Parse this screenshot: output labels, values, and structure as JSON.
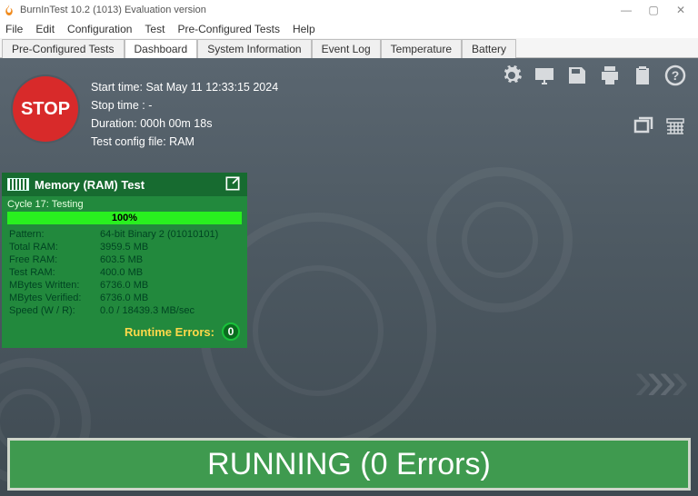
{
  "window": {
    "title": "BurnInTest 10.2 (1013) Evaluation version"
  },
  "menu": {
    "items": [
      "File",
      "Edit",
      "Configuration",
      "Test",
      "Pre-Configured Tests",
      "Help"
    ]
  },
  "tabs": {
    "items": [
      "Pre-Configured Tests",
      "Dashboard",
      "System Information",
      "Event Log",
      "Temperature",
      "Battery"
    ],
    "active": "Dashboard"
  },
  "stop_label": "STOP",
  "info": {
    "start_label": "Start time:",
    "start_value": "Sat May 11 12:33:15 2024",
    "stop_label": "Stop time :",
    "stop_value": "-",
    "duration_label": "Duration:",
    "duration_value": "000h 00m 18s",
    "config_label": "Test config file:",
    "config_value": "RAM"
  },
  "panel": {
    "title": "Memory (RAM) Test",
    "cycle": "Cycle 17: Testing",
    "progress_pct": "100%",
    "progress_fill": "100%",
    "rows": [
      {
        "k": "Pattern:",
        "v": "64-bit Binary 2 (01010101)"
      },
      {
        "k": "Total RAM:",
        "v": "3959.5 MB"
      },
      {
        "k": "Free RAM:",
        "v": "603.5 MB"
      },
      {
        "k": "Test RAM:",
        "v": "400.0 MB"
      },
      {
        "k": "MBytes Written:",
        "v": "6736.0 MB"
      },
      {
        "k": "MBytes Verified:",
        "v": "6736.0 MB"
      },
      {
        "k": "Speed (W / R):",
        "v": "0.0 / 18439.3  MB/sec"
      }
    ],
    "errors_label": "Runtime Errors:",
    "errors_value": "0"
  },
  "status": {
    "text": "RUNNING (0 Errors)"
  },
  "icons": {
    "settings": "settings",
    "monitor": "monitor",
    "save": "save",
    "print": "print",
    "clipboard": "clipboard",
    "help": "help",
    "windowed": "windowed",
    "calendar": "calendar",
    "popout": "popout"
  }
}
